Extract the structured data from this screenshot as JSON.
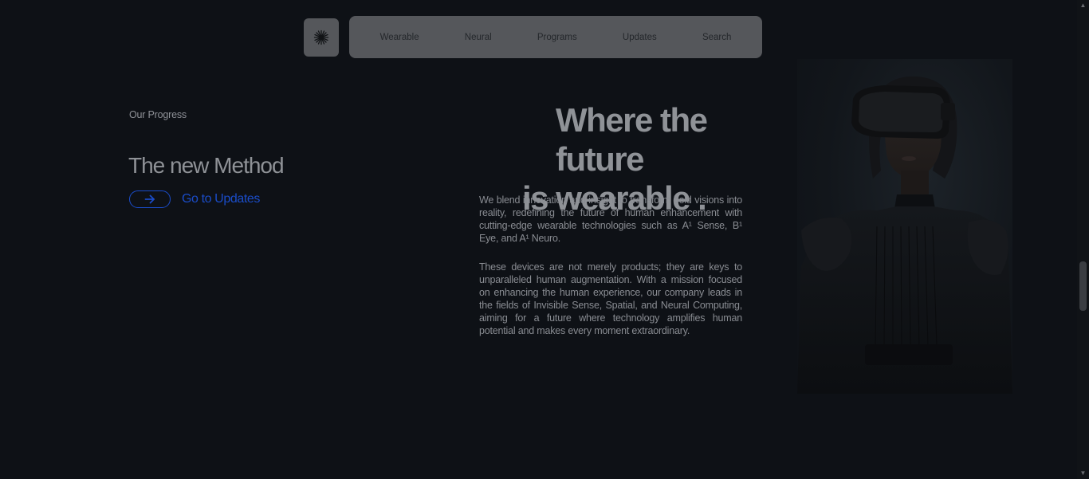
{
  "nav": {
    "logo_icon": "asterisk-logo-icon",
    "items": [
      {
        "label": "Wearable"
      },
      {
        "label": "Neural"
      },
      {
        "label": "Programs"
      },
      {
        "label": "Updates"
      },
      {
        "label": "Search"
      }
    ]
  },
  "progress": {
    "eyebrow": "Our Progress",
    "title": "The new Method",
    "link_label": "Go to Updates",
    "link_icon": "arrow-right-icon",
    "accent_color": "#1a4cc8"
  },
  "hero": {
    "headline_line1": "Where the future",
    "headline_line2": "is wearable .",
    "paragraph1": "We blend innovation and insight to transform bold visions into reality, redefining the future of human enhancement with cutting-edge wearable technologies such as A¹ Sense, B¹ Eye, and A¹ Neuro.",
    "paragraph2": "These devices are not merely products; they are keys to unparalleled human augmentation. With a mission focused on enhancing the human experience, our company leads in the fields of Invisible Sense, Spatial, and Neural Computing, aiming for a future where technology amplifies human potential and makes every moment extraordinary.",
    "image_alt": "Woman in black dress wearing VR headset"
  },
  "colors": {
    "background": "#0e1116",
    "nav_bg": "#55575b",
    "text": "#8f9297"
  }
}
